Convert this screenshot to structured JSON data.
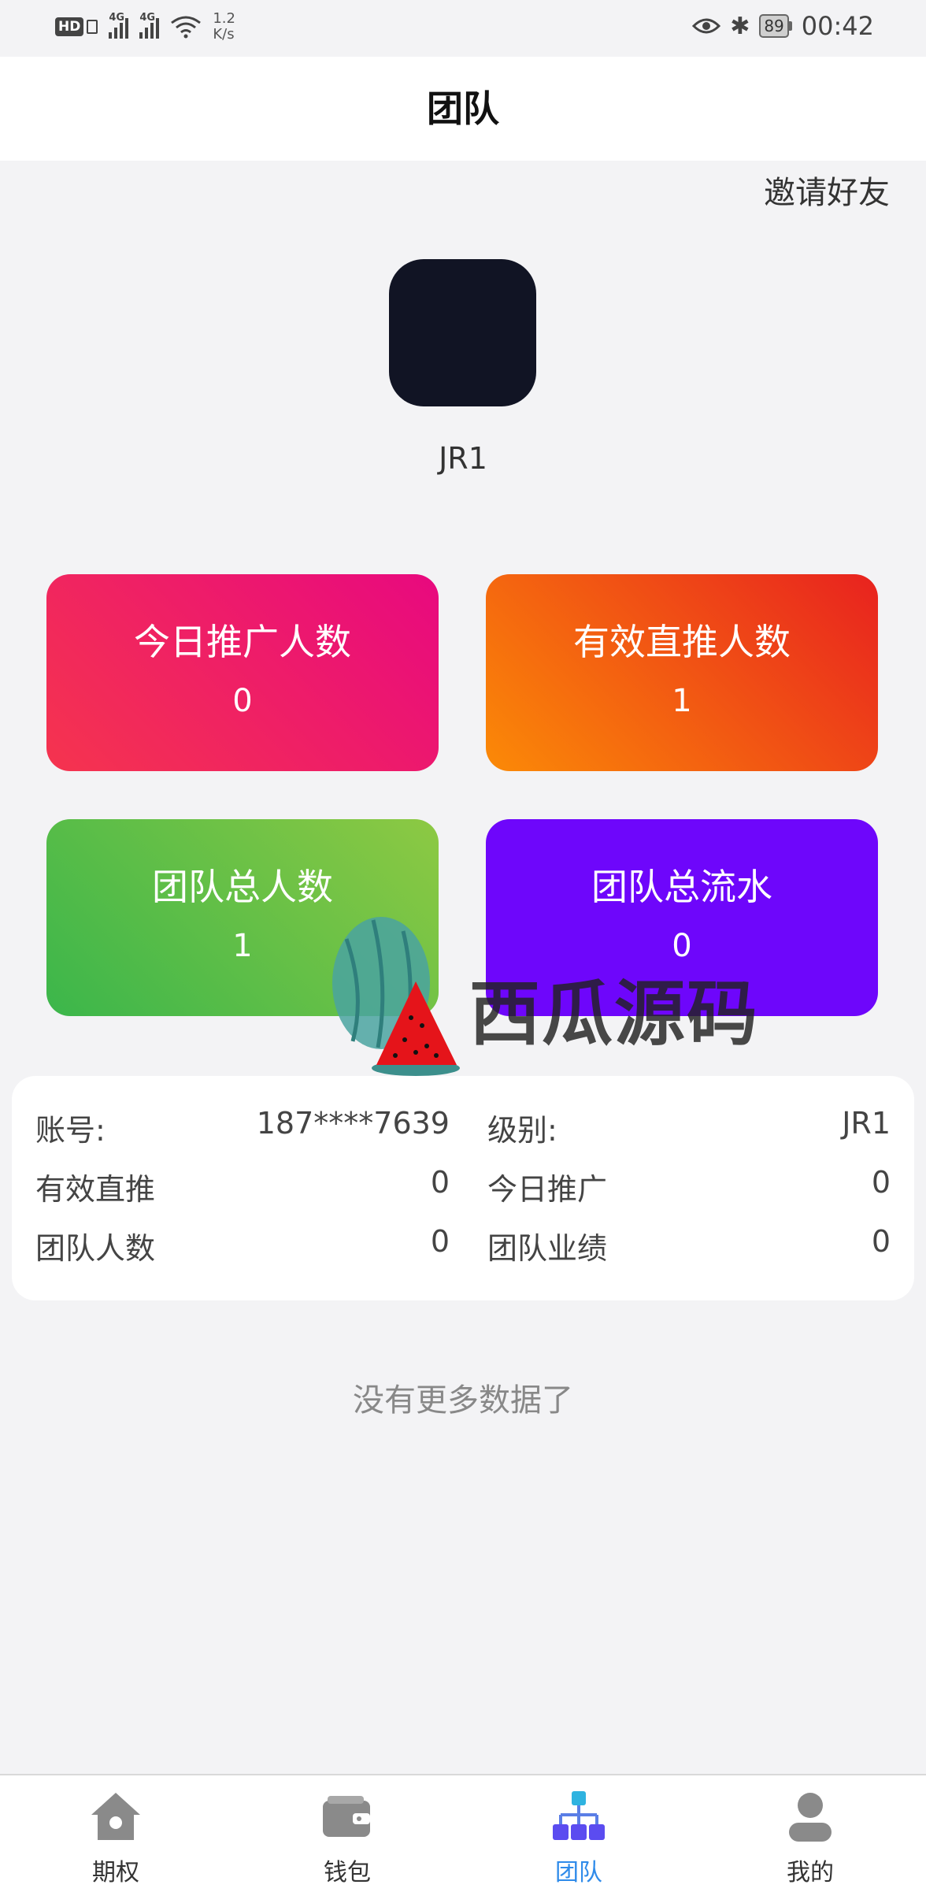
{
  "status_bar": {
    "hd": "HD",
    "signal1_tag": "4G",
    "signal2_tag": "4G",
    "speed_value": "1.2",
    "speed_unit": "K/s",
    "battery": "89",
    "time": "00:42"
  },
  "header": {
    "title": "团队"
  },
  "invite_label": "邀请好友",
  "profile": {
    "level_name": "JR1"
  },
  "stats": [
    {
      "label": "今日推广人数",
      "value": "0"
    },
    {
      "label": "有效直推人数",
      "value": "1"
    },
    {
      "label": "团队总人数",
      "value": "1"
    },
    {
      "label": "团队总流水",
      "value": "0"
    }
  ],
  "watermark": {
    "text": "西瓜源码"
  },
  "info": {
    "rows": [
      {
        "k1": "账号:",
        "v1": "187****7639",
        "k2": "级别:",
        "v2": "JR1"
      },
      {
        "k1": "有效直推",
        "v1": "0",
        "k2": "今日推广",
        "v2": "0"
      },
      {
        "k1": "团队人数",
        "v1": "0",
        "k2": "团队业绩",
        "v2": "0"
      }
    ]
  },
  "no_more_text": "没有更多数据了",
  "tabbar": {
    "items": [
      {
        "label": "期权",
        "icon": "home-icon"
      },
      {
        "label": "钱包",
        "icon": "wallet-icon"
      },
      {
        "label": "团队",
        "icon": "team-hierarchy-icon",
        "active": true
      },
      {
        "label": "我的",
        "icon": "user-icon"
      }
    ],
    "active_color": "#2f8bea"
  },
  "colors": {
    "card1": [
      "#f5344e",
      "#e8097f"
    ],
    "card2": [
      "#fb8a07",
      "#e8221f"
    ],
    "card3": [
      "#3bb64b",
      "#8dc943"
    ],
    "card4": "#6e06fb",
    "avatar": "#111424"
  }
}
